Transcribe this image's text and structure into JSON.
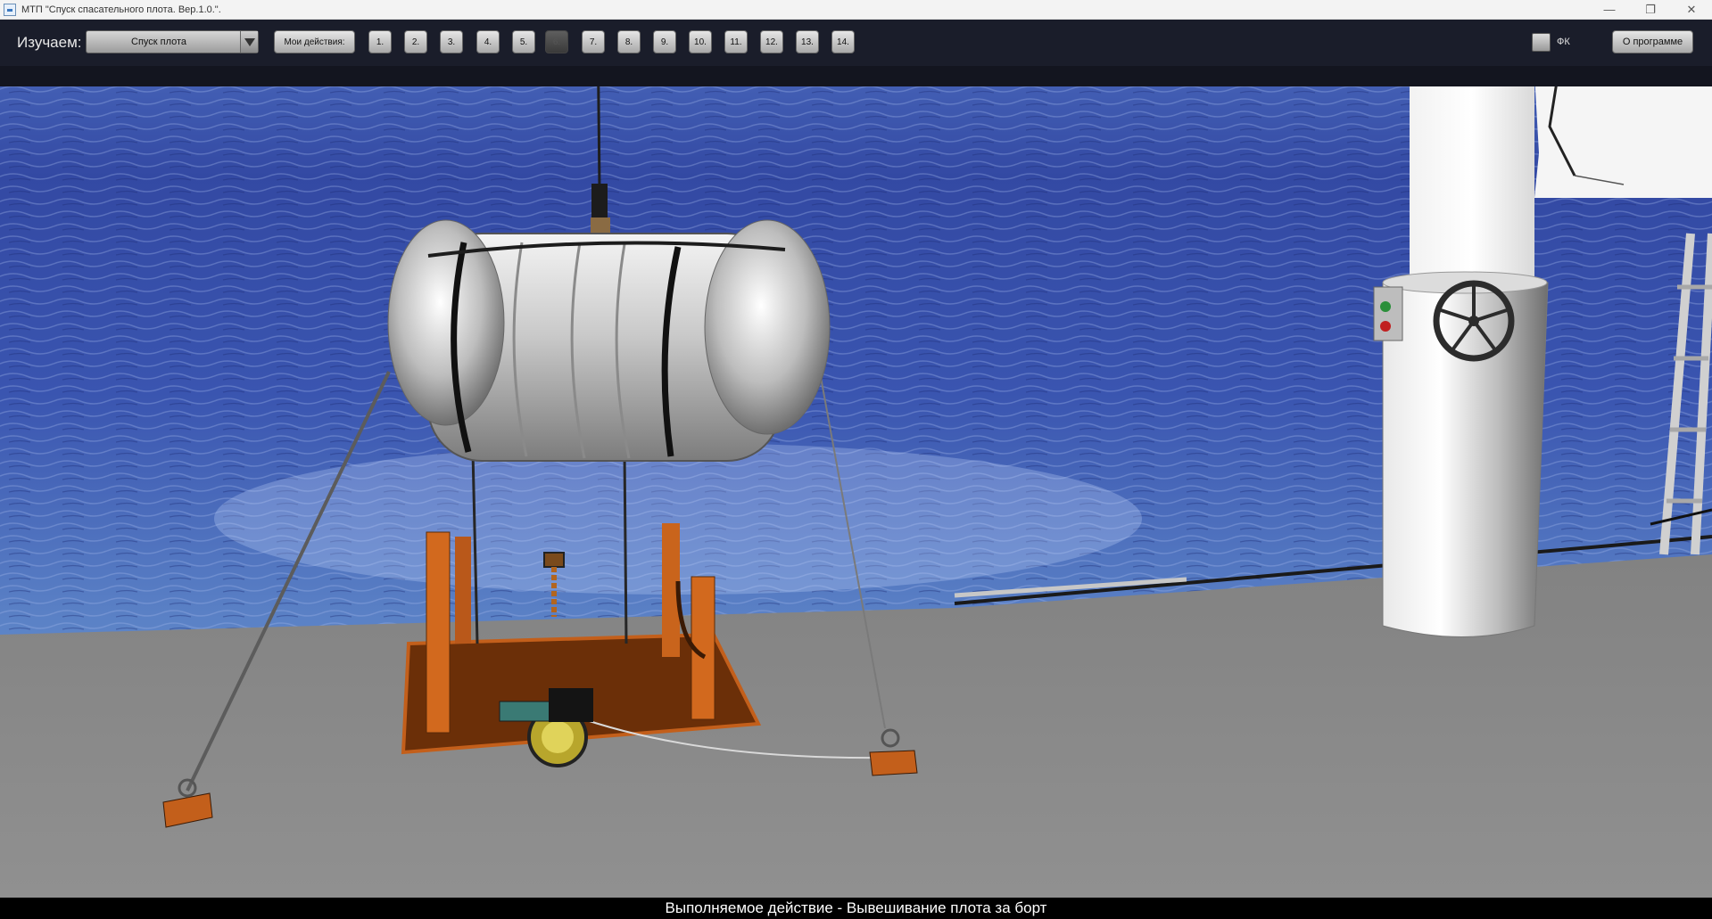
{
  "window": {
    "title": "МТП \"Спуск спасательного плота. Вер.1.0.\".",
    "minimize_glyph": "—",
    "maximize_glyph": "❐",
    "close_glyph": "✕"
  },
  "toolbar": {
    "study_label": "Изучаем:",
    "study_selected": "Спуск плота",
    "my_actions_label": "Мои действия:",
    "steps": [
      {
        "label": "1.",
        "enabled": true
      },
      {
        "label": "2.",
        "enabled": true
      },
      {
        "label": "3.",
        "enabled": true
      },
      {
        "label": "4.",
        "enabled": true
      },
      {
        "label": "5.",
        "enabled": true
      },
      {
        "label": "6.",
        "enabled": false
      },
      {
        "label": "7.",
        "enabled": true
      },
      {
        "label": "8.",
        "enabled": true
      },
      {
        "label": "9.",
        "enabled": true
      },
      {
        "label": "10.",
        "enabled": true
      },
      {
        "label": "11.",
        "enabled": true
      },
      {
        "label": "12.",
        "enabled": true
      },
      {
        "label": "13.",
        "enabled": true
      },
      {
        "label": "14.",
        "enabled": true
      }
    ],
    "fk_label": "ФК",
    "about_label": "О программе"
  },
  "status": {
    "text": "Выполняемое действие - Вывешивание плота за борт"
  },
  "colors": {
    "sea": "#2e3f9a",
    "sky": "#3b57a8",
    "deck": "#8b8b8b",
    "cradle": "#d2691e"
  },
  "icons": {
    "dropdown": "chevron-down-icon",
    "window": "app-icon"
  }
}
